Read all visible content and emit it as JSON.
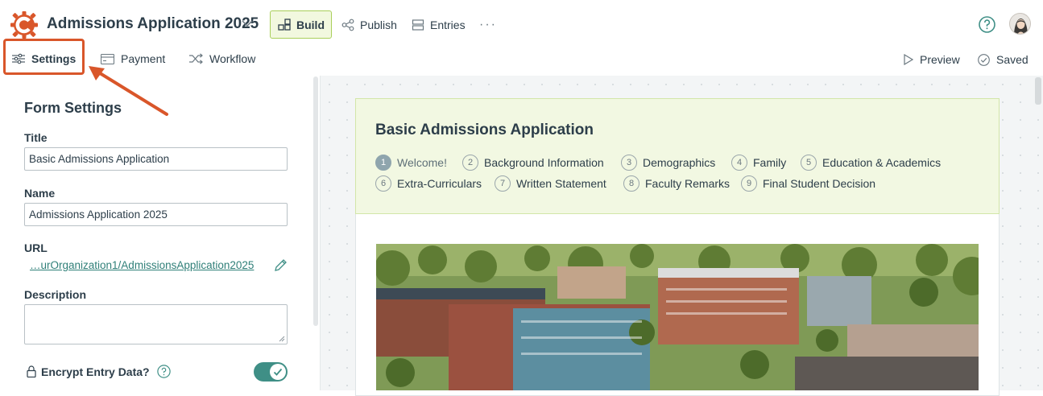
{
  "header": {
    "app_title": "Admissions Application 2025",
    "nav": {
      "build": "Build",
      "publish": "Publish",
      "entries": "Entries",
      "more": "···"
    }
  },
  "subnav": {
    "settings": "Settings",
    "payment": "Payment",
    "workflow": "Workflow",
    "preview": "Preview",
    "saved": "Saved"
  },
  "sidebar": {
    "heading": "Form Settings",
    "title_label": "Title",
    "title_value": "Basic Admissions Application",
    "name_label": "Name",
    "name_value": "Admissions Application 2025",
    "url_label": "URL",
    "url_prefix": "…",
    "url_value": "urOrganization1/AdmissionsApplication2025",
    "description_label": "Description",
    "encrypt_label": "Encrypt Entry Data?"
  },
  "form": {
    "title": "Basic Admissions Application",
    "steps": [
      {
        "num": "1",
        "label": "Welcome!"
      },
      {
        "num": "2",
        "label": "Background Information"
      },
      {
        "num": "3",
        "label": "Demographics"
      },
      {
        "num": "4",
        "label": "Family"
      },
      {
        "num": "5",
        "label": "Education & Academics"
      },
      {
        "num": "6",
        "label": "Extra-Curriculars"
      },
      {
        "num": "7",
        "label": "Written Statement"
      },
      {
        "num": "8",
        "label": "Faculty Remarks"
      },
      {
        "num": "9",
        "label": "Final Student Decision"
      }
    ]
  },
  "colors": {
    "accent": "#3f8f86",
    "highlight": "#d9562a",
    "build_bg": "#f2f8df",
    "form_header_bg": "#f2f8e2"
  }
}
